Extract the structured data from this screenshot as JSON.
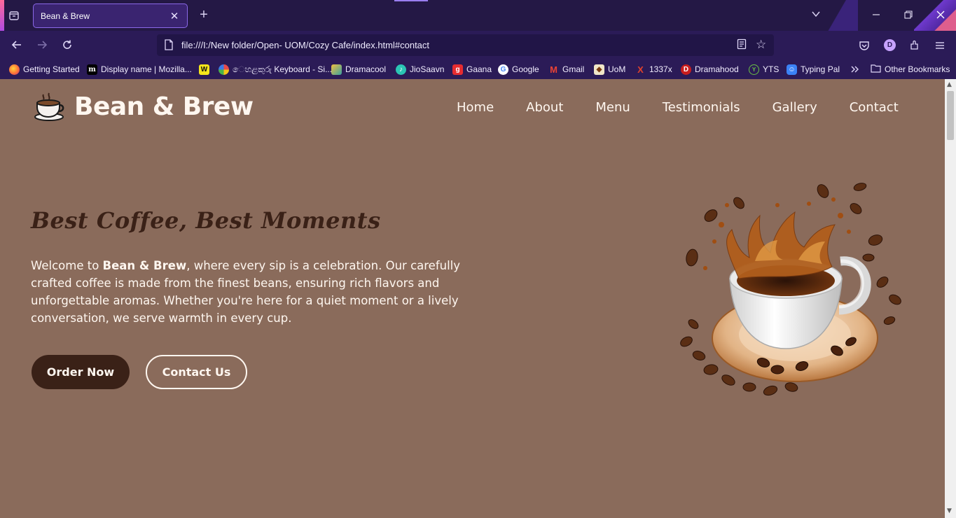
{
  "browser": {
    "tab_title": "Bean & Brew",
    "url": "file:///I:/New folder/Open- UOM/Cozy Cafe/index.html#contact",
    "profile_initial": "D",
    "bookmarks": [
      {
        "label": "Getting Started",
        "icon": "firefox-icon",
        "color": "#ff7139"
      },
      {
        "label": "Display name | Mozilla...",
        "icon": "mozilla-m-icon",
        "color": "#000000"
      },
      {
        "label": "",
        "icon": "w-square-icon",
        "color": "#f5e51b"
      },
      {
        "label": "ෙහළකුරු Keyboard - Si...",
        "icon": "flower-icon",
        "color": "#e84a4a"
      },
      {
        "label": "Dramacool",
        "icon": "dramacool-icon",
        "color": "#3aa0a0"
      },
      {
        "label": "JioSaavn",
        "icon": "jiosaavn-icon",
        "color": "#2bc5b4"
      },
      {
        "label": "Gaana",
        "icon": "gaana-icon",
        "color": "#e72c30"
      },
      {
        "label": "Google",
        "icon": "google-icon",
        "color": "#ffffff"
      },
      {
        "label": "Gmail",
        "icon": "gmail-icon",
        "color": "#ea4335"
      },
      {
        "label": "UoM",
        "icon": "uom-crest-icon",
        "color": "#f0e6c8"
      },
      {
        "label": "1337x",
        "icon": "x-icon",
        "color": "#e2422b"
      },
      {
        "label": "Dramahood",
        "icon": "dramahood-icon",
        "color": "#c81e1e"
      },
      {
        "label": "YTS",
        "icon": "yts-icon",
        "color": "#6ac045"
      },
      {
        "label": "Typing Pal",
        "icon": "typingpal-icon",
        "color": "#3b82f6"
      }
    ],
    "other_bookmarks": "Other Bookmarks"
  },
  "site": {
    "brand": "Bean & Brew",
    "nav": [
      "Home",
      "About",
      "Menu",
      "Testimonials",
      "Gallery",
      "Contact"
    ],
    "headline": "Best Coffee, Best Moments",
    "intro_prefix": "Welcome to ",
    "intro_brand": "Bean & Brew",
    "intro_suffix": ", where every sip is a celebration. Our carefully crafted coffee is made from the finest beans, ensuring rich flavors and unforgettable aromas. Whether you're here for a quiet moment or a lively conversation, we serve warmth in every cup.",
    "order_button": "Order Now",
    "contact_button": "Contact Us",
    "colors": {
      "background": "#8a6b5b",
      "dark_brown": "#3a2117",
      "cream": "#fff7f0"
    }
  }
}
